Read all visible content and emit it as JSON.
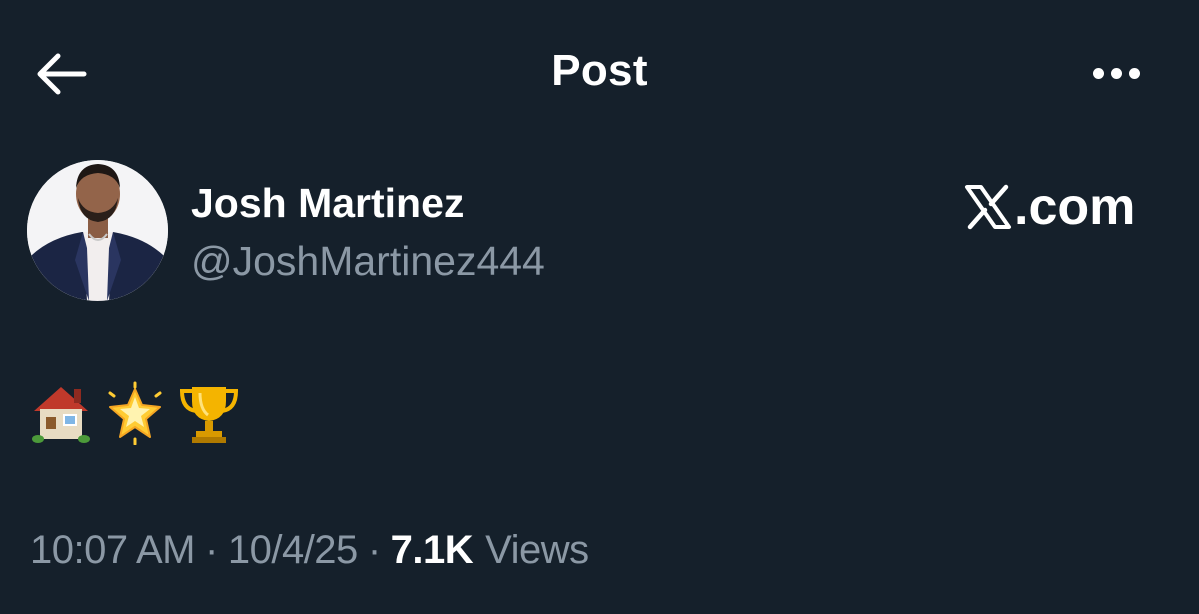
{
  "header": {
    "title": "Post",
    "back_icon": "arrow-left-icon",
    "more_icon": "more-horizontal-icon"
  },
  "author": {
    "display_name": "Josh Martinez",
    "handle": "@JoshMartinez444"
  },
  "watermark": {
    "logo_icon": "x-logo-icon",
    "text": ".com"
  },
  "tweet": {
    "emojis": [
      "house-emoji",
      "glowing-star-emoji",
      "trophy-emoji"
    ]
  },
  "meta": {
    "time": "10:07 AM",
    "separator": "·",
    "date": "10/4/25",
    "views_count": "7.1K",
    "views_label": "Views"
  },
  "colors": {
    "background": "#15202b",
    "text": "#ffffff",
    "secondary_text": "#8b98a5"
  }
}
